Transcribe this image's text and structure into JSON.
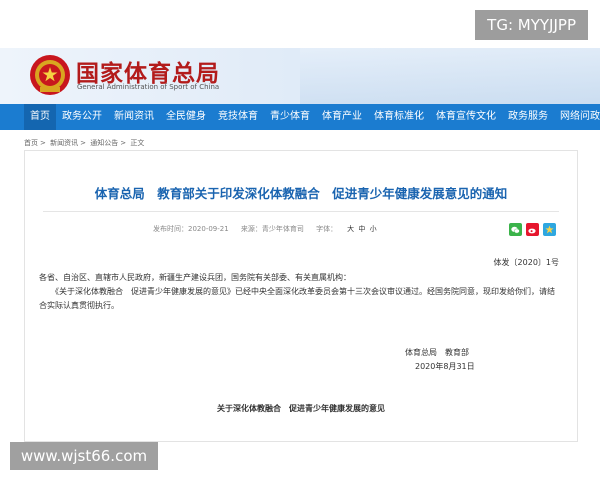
{
  "watermarks": {
    "top_right": "TG: MYYJJPP",
    "bottom_left": "www.wjst66.com"
  },
  "header": {
    "title": "国家体育总局",
    "subtitle": "General Administration of Sport of China",
    "emblem_icon": "national-emblem-icon",
    "title_color": "#b31b1b"
  },
  "nav": {
    "bg_color": "#1b7cd0",
    "items": [
      {
        "label": "首页"
      },
      {
        "label": "政务公开"
      },
      {
        "label": "新闻资讯"
      },
      {
        "label": "全民健身"
      },
      {
        "label": "竞技体育"
      },
      {
        "label": "青少体育"
      },
      {
        "label": "体育产业"
      },
      {
        "label": "体育标准化"
      },
      {
        "label": "体育宣传文化"
      },
      {
        "label": "政务服务"
      },
      {
        "label": "网络问政"
      }
    ]
  },
  "breadcrumb": {
    "items": [
      "首页",
      "新闻资讯",
      "通知公告",
      "正文"
    ],
    "separator": ">"
  },
  "article": {
    "title": "体育总局　教育部关于印发深化体教融合　促进青少年健康发展意见的通知",
    "title_color": "#1a64b0",
    "meta": {
      "date": "发布时间：2020-09-21",
      "source": "来源：青少年体育司",
      "font_label": "字体：",
      "sizes": [
        "大",
        "中",
        "小"
      ]
    },
    "share_icons": [
      "wechat-icon",
      "weibo-icon",
      "qzone-icon"
    ],
    "doc_number": "体发〔2020〕1号",
    "recipients": "各省、自治区、直辖市人民政府，新疆生产建设兵团，国务院有关部委、有关直属机构：",
    "body": "　　《关于深化体教融合　促进青少年健康发展的意见》已经中央全面深化改革委员会第十三次会议审议通过。经国务院同意，现印发给你们，请结合实际认真贯彻执行。",
    "signer": "体育总局　教育部",
    "sign_date": "2020年8月31日",
    "attachment_title": "关于深化体教融合　促进青少年健康发展的意见"
  }
}
